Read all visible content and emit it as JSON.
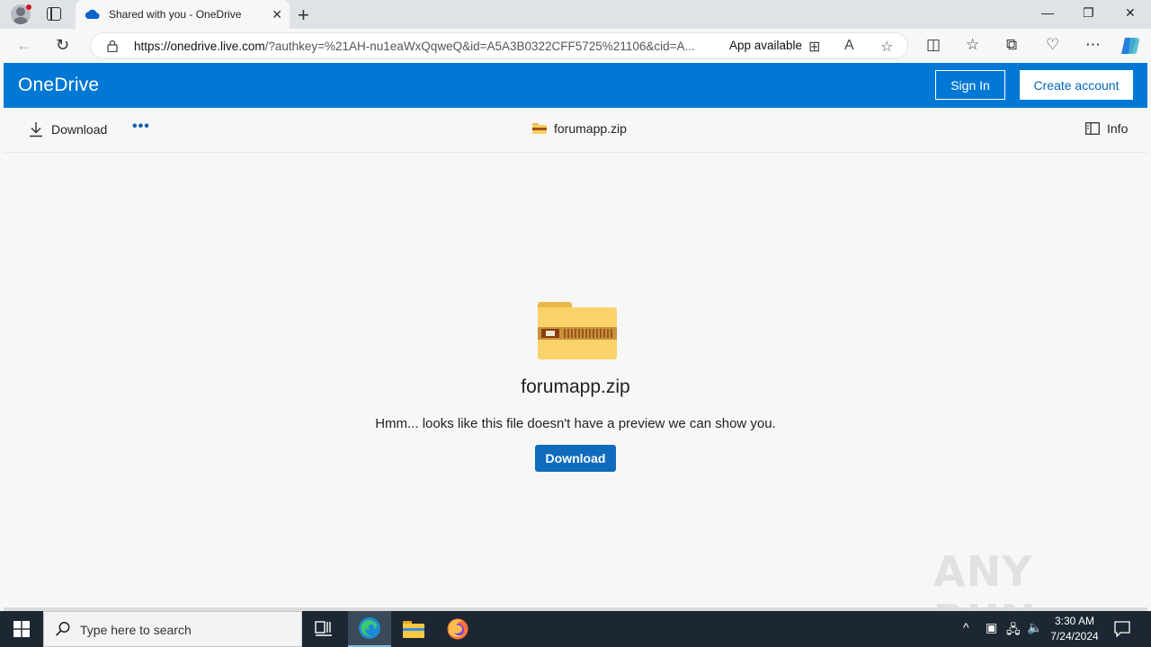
{
  "browser": {
    "tab_title": "Shared with you - OneDrive",
    "url_host": "https://onedrive.live.com",
    "url_rest": "/?authkey=%21AH-nu1eaWxQqweQ&id=A5A3B0322CFF5725%21106&cid=A...",
    "app_available": "App available",
    "new_tab_label": "+",
    "minimize": "—",
    "maximize": "❐",
    "close": "✕"
  },
  "header": {
    "brand": "OneDrive",
    "signin_label": "Sign In",
    "create_account_label": "Create account",
    "brand_color": "#0078d4"
  },
  "commandbar": {
    "download_label": "Download",
    "more_label": "•••",
    "file_name": "forumapp.zip",
    "info_label": "Info"
  },
  "preview": {
    "file_name": "forumapp.zip",
    "message": "Hmm... looks like this file doesn't have a preview we can show you.",
    "download_label": "Download"
  },
  "watermark": "ANY RUN",
  "taskbar": {
    "search_placeholder": "Type here to search",
    "time": "3:30 AM",
    "date": "7/24/2024"
  },
  "icons": [
    "windows-start-icon",
    "search-icon",
    "task-view-icon",
    "edge-icon",
    "file-explorer-icon",
    "firefox-icon",
    "zip-folder-icon",
    "download-icon",
    "info-icon"
  ]
}
